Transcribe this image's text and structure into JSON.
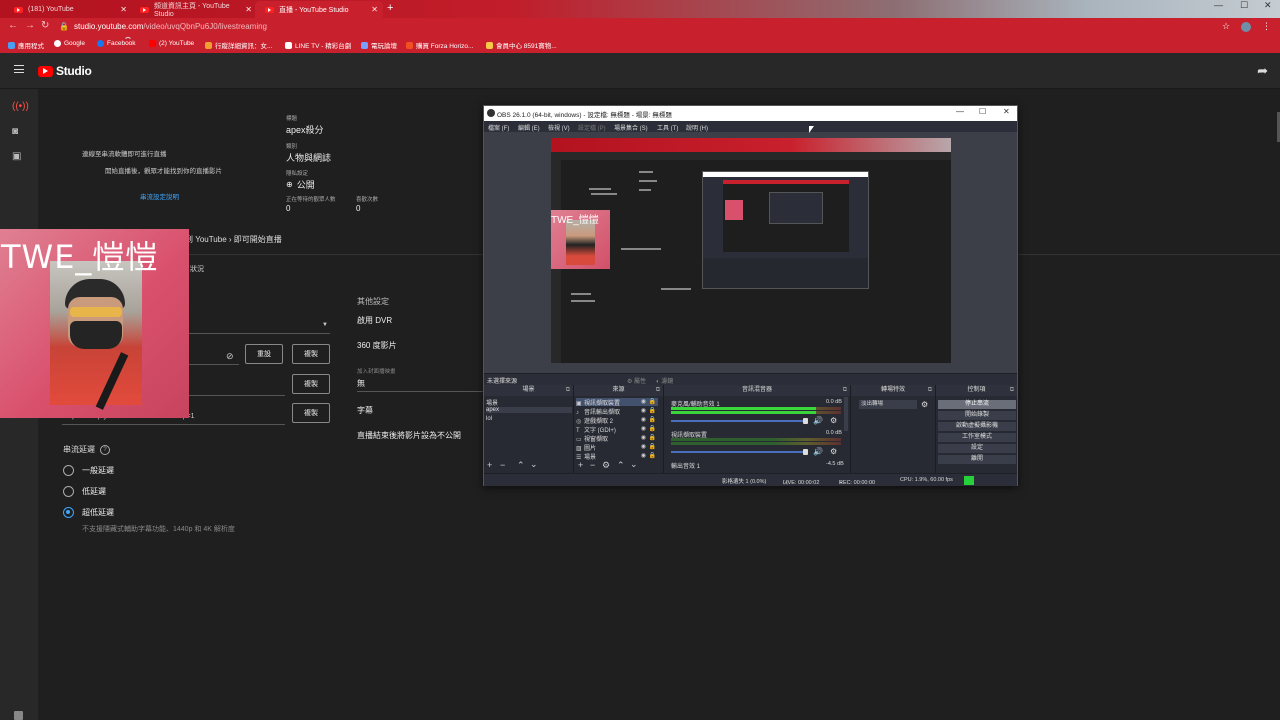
{
  "browser": {
    "tabs": [
      {
        "title": "(181) YouTube"
      },
      {
        "title": "頻道資訊主頁 - YouTube Studio"
      },
      {
        "title": "直播 - YouTube Studio"
      }
    ],
    "url": "studio.youtube.com",
    "url_path": "/video/uvqQbnPu6J0/livestreaming",
    "bookmarks": [
      {
        "label": "應用程式"
      },
      {
        "label": "Google"
      },
      {
        "label": "Facebook"
      },
      {
        "label": "(2) YouTube"
      },
      {
        "label": "行蹤詳細資訊：女..."
      },
      {
        "label": "LINE TV - 精彩台劇"
      },
      {
        "label": "電玩論壇"
      },
      {
        "label": "購買 Forza Horizo..."
      },
      {
        "label": "會員中心 8591寶物..."
      }
    ]
  },
  "studio": {
    "logo_text": "Studio",
    "preview": {
      "line1": "連線至串流軟體即可進行直播",
      "line2": "開始直播後，觀眾才能找到你的直播影片",
      "link": "串流設定說明"
    },
    "meta": {
      "title_label": "標題",
      "title_value": "apex殺分",
      "category_label": "類別",
      "category_value": "人物與網誌",
      "privacy_label": "隱私設定",
      "privacy_value": "公開",
      "viewers_label": "正在等待的觀眾人數",
      "viewers_value": "0",
      "likes_label": "喜歡次數",
      "likes_value": "0"
    },
    "breadcrumb": "到 YouTube › 即可開始直播",
    "status_partial": "狀況",
    "buttons": {
      "reset": "重設",
      "copy1": "複製",
      "copy2": "複製",
      "copy3": "複製"
    },
    "backup_url": "rtmp://b.rtmp.youtube.com/live2?backup=1",
    "advanced": {
      "heading": "其他設定",
      "dvr": "啟用 DVR",
      "vr360": "360 度影片",
      "delay_small": "加入封面播映畫",
      "delay_value": "無",
      "captions": "字幕",
      "unlist": "直播結束後將影片設為不公開"
    },
    "latency": {
      "heading": "串流延遲",
      "options": [
        {
          "label": "一般延遲",
          "selected": false
        },
        {
          "label": "低延遲",
          "selected": false
        },
        {
          "label": "超低延遲",
          "selected": true
        }
      ],
      "note": "不支援隱藏式輔助字幕功能、1440p 和 4K 解析度"
    }
  },
  "webcam": {
    "overlay_text": "TWE_愷愷",
    "mini_text": "TWE_愷愷"
  },
  "obs": {
    "title": "OBS 26.1.0 (64-bit, windows) - 設定檔: 無標題 - 場景: 無標題",
    "menu": [
      "檔案 (F)",
      "編輯 (E)",
      "檢視 (V)",
      "設定檔 (P)",
      "場景集合 (S)",
      "工具 (T)",
      "說明 (H)"
    ],
    "toolbar": {
      "no_source": "未選擇來源",
      "properties": "屬性",
      "filters": "濾鏡"
    },
    "docks": {
      "scenes": "場景",
      "sources": "來源",
      "mixer": "音訊混音器",
      "transitions": "轉場特效",
      "controls": "控制項"
    },
    "scenes": [
      {
        "name": "場景",
        "selected": false
      },
      {
        "name": "apex",
        "selected": true
      },
      {
        "name": "lol",
        "selected": false
      }
    ],
    "sources": [
      {
        "name": "視訊擷取裝置",
        "icon": "camera-icon",
        "selected": true
      },
      {
        "name": "音訊輸出擷取",
        "icon": "mic-icon",
        "selected": false
      },
      {
        "name": "遊戲擷取 2",
        "icon": "gamepad-icon",
        "selected": false
      },
      {
        "name": "文字 (GDI+)",
        "icon": "text-icon",
        "selected": false
      },
      {
        "name": "視窗擷取",
        "icon": "window-icon",
        "selected": false
      },
      {
        "name": "圖片",
        "icon": "image-icon",
        "selected": false
      },
      {
        "name": "場景",
        "icon": "scene-icon",
        "selected": false
      }
    ],
    "mixer": [
      {
        "name": "麥克風/輔助音效 1",
        "db": "0.0 dB",
        "level": 0.85
      },
      {
        "name": "視訊擷取裝置",
        "db": "0.0 dB",
        "level": 0.0
      },
      {
        "name": "輸出音效 1",
        "db": "-4.5 dB",
        "level": 0.0
      }
    ],
    "transition": "淡出轉場",
    "controls": [
      {
        "label": "停止串流",
        "active": true
      },
      {
        "label": "開始錄製",
        "active": false
      },
      {
        "label": "啟動虛擬攝影機",
        "active": false
      },
      {
        "label": "工作室模式",
        "active": false
      },
      {
        "label": "設定",
        "active": false
      },
      {
        "label": "離開",
        "active": false
      }
    ],
    "status": {
      "dropped": "影格遺失 1 (0.0%)",
      "live": "LIVE: 00:00:02",
      "rec": "REC: 00:00:00",
      "cpu": "CPU: 1.9%, 60.00 fps"
    }
  },
  "colors": {
    "browser_red": "#c9202d",
    "yt_red": "#ff0000",
    "studio_bg": "#1f1f1f",
    "accent_blue": "#3ea6ff",
    "obs_bg": "#2b2e38",
    "live_green": "#25d23a"
  }
}
